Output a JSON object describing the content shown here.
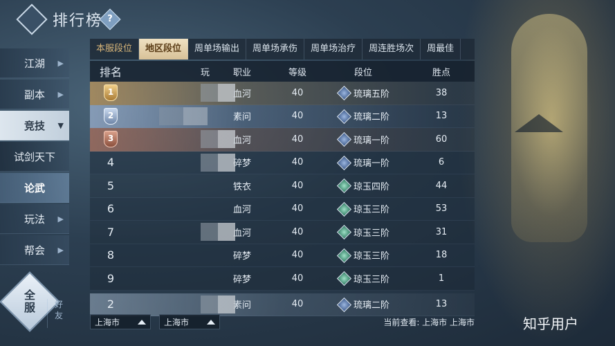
{
  "header": {
    "title": "排行榜",
    "help": "?"
  },
  "nav": {
    "items": [
      {
        "label": "江湖"
      },
      {
        "label": "副本"
      },
      {
        "label": "竞技"
      },
      {
        "label": "试剑天下"
      },
      {
        "label": "论武"
      },
      {
        "label": "玩法"
      },
      {
        "label": "帮会"
      }
    ]
  },
  "scope": {
    "all": "全\n服",
    "friends": "好\n友"
  },
  "tabs": [
    "本服段位",
    "地区段位",
    "周单场输出",
    "周单场承伤",
    "周单场治疗",
    "周连胜场次",
    "周最佳"
  ],
  "table": {
    "headers": [
      "排名",
      "玩",
      "职业",
      "等级",
      "段位",
      "胜点"
    ],
    "rows": [
      {
        "rank": "1",
        "job": "血河",
        "level": "40",
        "segment": "琉璃五阶",
        "points": "38"
      },
      {
        "rank": "2",
        "job": "素问",
        "level": "40",
        "segment": "琉璃二阶",
        "points": "13"
      },
      {
        "rank": "3",
        "job": "血河",
        "level": "40",
        "segment": "琉璃一阶",
        "points": "60"
      },
      {
        "rank": "4",
        "job": "碎梦",
        "level": "40",
        "segment": "琉璃一阶",
        "points": "6"
      },
      {
        "rank": "5",
        "job": "铁衣",
        "level": "40",
        "segment": "琼玉四阶",
        "points": "44"
      },
      {
        "rank": "6",
        "job": "血河",
        "level": "40",
        "segment": "琼玉三阶",
        "points": "53"
      },
      {
        "rank": "7",
        "job": "血河",
        "level": "40",
        "segment": "琼玉三阶",
        "points": "31"
      },
      {
        "rank": "8",
        "job": "碎梦",
        "level": "40",
        "segment": "琼玉三阶",
        "points": "18"
      },
      {
        "rank": "9",
        "job": "碎梦",
        "level": "40",
        "segment": "琼玉三阶",
        "points": "1"
      }
    ],
    "self": {
      "rank": "2",
      "job": "素问",
      "level": "40",
      "segment": "琉璃二阶",
      "points": "13"
    }
  },
  "filters": {
    "province": "上海市",
    "city": "上海市"
  },
  "current_view": "当前查看: 上海市 上海市",
  "watermark": "知乎用户"
}
